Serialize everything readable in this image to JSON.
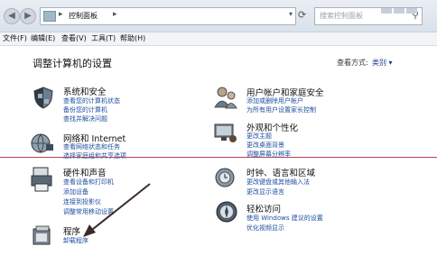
{
  "addressbar": {
    "breadcrumb": "控制面板",
    "search_placeholder": "搜索控制面板"
  },
  "menu": [
    "文件(F)",
    "编辑(E)",
    "查看(V)",
    "工具(T)",
    "帮助(H)"
  ],
  "main": {
    "heading": "调整计算机的设置",
    "view_by_label": "查看方式:",
    "view_by_value": "类别 ▾"
  },
  "categories": [
    {
      "title": "系统和安全",
      "links": [
        "查看您的计算机状态",
        "备份您的计算机",
        "查找并解决问题"
      ],
      "icon": "shield-icon"
    },
    {
      "title": "网络和 Internet",
      "links": [
        "查看网络状态和任务",
        "选择家庭组和共享选项"
      ],
      "icon": "network-globe-icon"
    },
    {
      "title": "硬件和声音",
      "links": [
        "查看设备和打印机",
        "添加设备",
        "连接到投影仪",
        "调整常用移动设置"
      ],
      "icon": "printer-icon"
    },
    {
      "title": "程序",
      "links": [
        "卸载程序"
      ],
      "icon": "programs-icon"
    },
    {
      "title": "用户帐户和家庭安全",
      "links": [
        "添加或删除用户帐户",
        "为所有用户设置家长控制"
      ],
      "icon": "users-icon"
    },
    {
      "title": "外观和个性化",
      "links": [
        "更改主题",
        "更改桌面背景",
        "调整屏幕分辨率"
      ],
      "icon": "display-icon"
    },
    {
      "title": "时钟、语言和区域",
      "links": [
        "更改键盘或其他输入法",
        "更改显示语言"
      ],
      "icon": "clock-globe-icon"
    },
    {
      "title": "轻松访问",
      "links": [
        "使用 Windows 建议的设置",
        "优化视频显示"
      ],
      "icon": "ease-of-access-icon"
    }
  ],
  "colors": {
    "link": "#1d4ea0",
    "annotation_line": "#b8415a",
    "arrow": "#3a2a2a"
  }
}
